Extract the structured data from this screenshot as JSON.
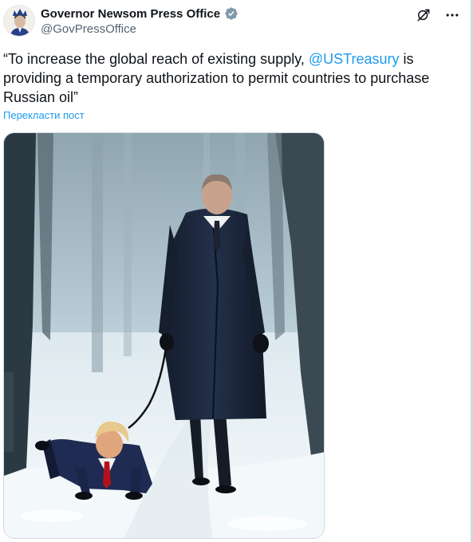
{
  "post": {
    "author_name": "Governor Newsom Press Office",
    "author_handle": "@GovPressOffice",
    "text_before": "“To increase the global reach of existing supply, ",
    "mention": "@USTreasury",
    "text_after": " is providing a temporary authorization to permit countries to purchase Russian oil”",
    "translate_label": "Перекласти пост"
  },
  "icons": {
    "verified": "verified-badge-icon",
    "grok": "grok-icon",
    "more": "more-icon"
  },
  "colors": {
    "accent": "#1d9bf0",
    "text": "#0f1419",
    "muted": "#536471"
  }
}
